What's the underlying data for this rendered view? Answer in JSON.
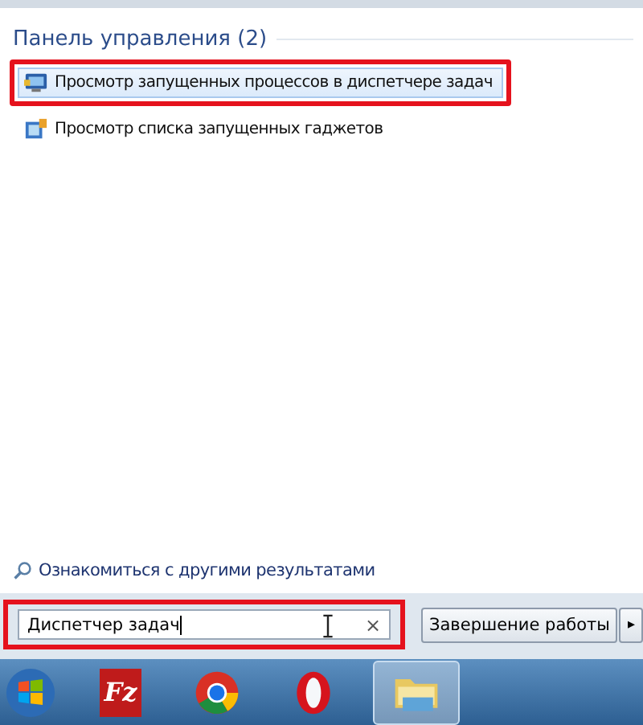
{
  "results": {
    "heading": "Панель управления (2)",
    "items": [
      {
        "label": "Просмотр запущенных процессов в диспетчере задач",
        "selected": true,
        "highlighted": true
      },
      {
        "label": "Просмотр списка запущенных гаджетов",
        "selected": false,
        "highlighted": false
      }
    ]
  },
  "more_results": "Ознакомиться с другими результатами",
  "search": {
    "value": "Диспетчер задач",
    "highlighted": true,
    "clear": "×"
  },
  "shutdown": {
    "label": "Завершение работы",
    "arrow": "▸"
  },
  "taskbar": [
    {
      "kind": "start",
      "active": false
    },
    {
      "kind": "filezilla",
      "label": "Fz",
      "active": false
    },
    {
      "kind": "chrome",
      "active": false
    },
    {
      "kind": "opera",
      "active": false
    },
    {
      "kind": "explorer",
      "active": true
    }
  ]
}
